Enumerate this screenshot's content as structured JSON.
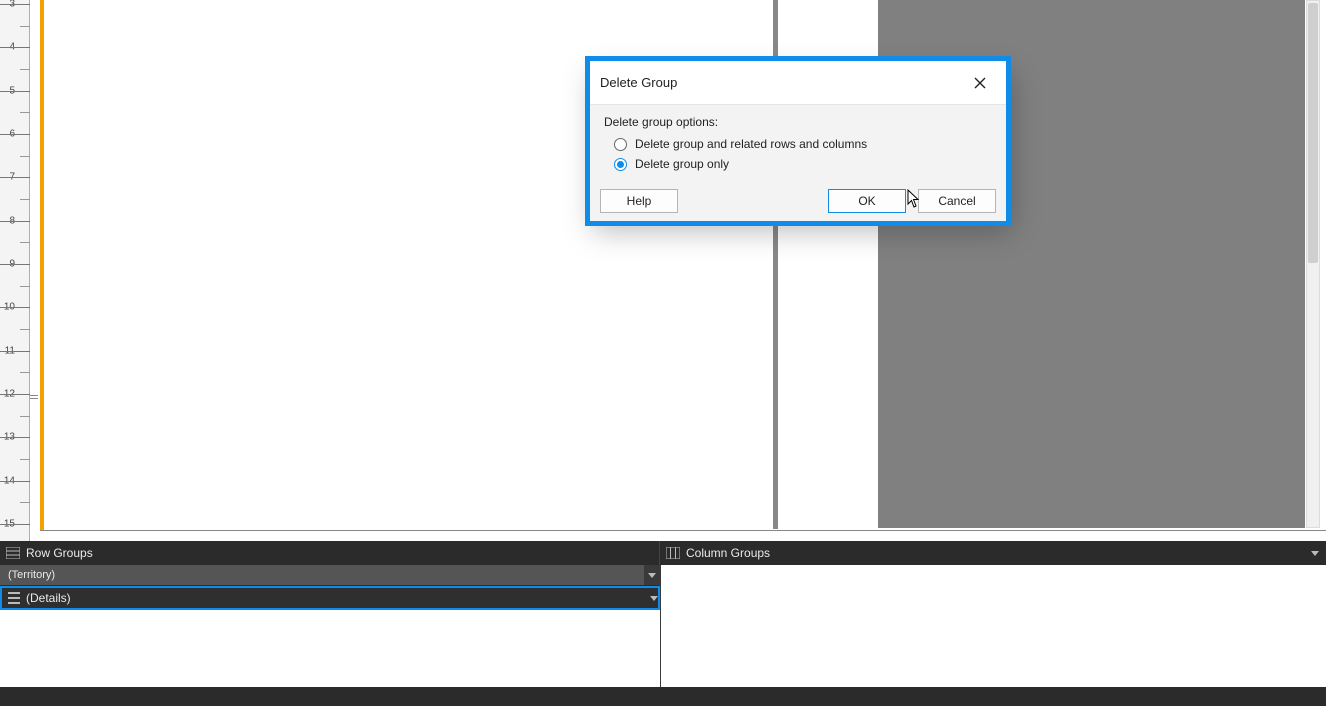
{
  "ruler": {
    "start": 3,
    "end": 15
  },
  "dialog": {
    "title": "Delete Group",
    "options_label": "Delete group options:",
    "option_full": "Delete group and related rows and columns",
    "option_only": "Delete group only",
    "selected": "only",
    "help": "Help",
    "ok": "OK",
    "cancel": "Cancel"
  },
  "groups": {
    "row_header": "Row Groups",
    "col_header": "Column Groups",
    "items": [
      {
        "name": "(Territory)",
        "selected": false
      },
      {
        "name": "(Details)",
        "selected": true
      }
    ]
  }
}
